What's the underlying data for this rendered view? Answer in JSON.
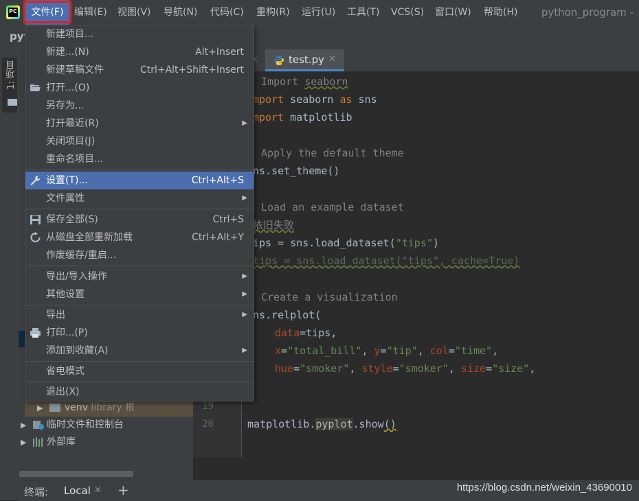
{
  "menubar": {
    "items": [
      "文件(F)",
      "编辑(E)",
      "视图(V)",
      "导航(N)",
      "代码(C)",
      "重构(R)",
      "运行(U)",
      "工具(T)",
      "VCS(S)",
      "窗口(W)",
      "帮助(H)"
    ],
    "project_title": "python_program -",
    "logo_text": "PC"
  },
  "navbar": {
    "crumb": "pyt"
  },
  "side_strip": {
    "project_tab": "1: 项目"
  },
  "file_menu": {
    "items": [
      {
        "label": "新建项目...",
        "shortcut": "",
        "icon": ""
      },
      {
        "label": "新建...(N)",
        "shortcut": "Alt+Insert",
        "icon": ""
      },
      {
        "label": "新建草稿文件",
        "shortcut": "Ctrl+Alt+Shift+Insert",
        "icon": ""
      },
      {
        "label": "打开...(O)",
        "shortcut": "",
        "icon": "folder-open-icon"
      },
      {
        "label": "另存为...",
        "shortcut": "",
        "icon": ""
      },
      {
        "label": "打开最近(R)",
        "shortcut": "",
        "icon": "",
        "submenu": true
      },
      {
        "label": "关闭项目(J)",
        "shortcut": "",
        "icon": ""
      },
      {
        "label": "重命名项目...",
        "shortcut": "",
        "icon": ""
      },
      {
        "label": "设置(T)...",
        "shortcut": "Ctrl+Alt+S",
        "icon": "wrench-icon",
        "selected": true
      },
      {
        "label": "文件属性",
        "shortcut": "",
        "icon": "",
        "submenu": true
      },
      {
        "label": "保存全部(S)",
        "shortcut": "Ctrl+S",
        "icon": "save-icon"
      },
      {
        "label": "从磁盘全部重新加载",
        "shortcut": "Ctrl+Alt+Y",
        "icon": "reload-icon"
      },
      {
        "label": "作废缓存/重启...",
        "shortcut": "",
        "icon": ""
      },
      {
        "label": "导出/导入操作",
        "shortcut": "",
        "icon": "",
        "submenu": true
      },
      {
        "label": "其他设置",
        "shortcut": "",
        "icon": "",
        "submenu": true
      },
      {
        "label": "导出",
        "shortcut": "",
        "icon": "",
        "submenu": true
      },
      {
        "label": "打印...(P)",
        "shortcut": "",
        "icon": "printer-icon"
      },
      {
        "label": "添加到收藏(A)",
        "shortcut": "",
        "icon": "",
        "submenu": true
      },
      {
        "label": "省电模式",
        "shortcut": "",
        "icon": ""
      },
      {
        "label": "退出(X)",
        "shortcut": "",
        "icon": ""
      }
    ]
  },
  "editor": {
    "tab": {
      "filename": "test.py"
    },
    "line_numbers": [
      "19",
      "20"
    ]
  },
  "project_tree": {
    "venv": {
      "name": "venv",
      "hint": "library 根"
    },
    "scratches": "临时文件和控制台",
    "external_libs": "外部库"
  },
  "bottom": {
    "terminal_label": "终端:",
    "terminal_tab": "Local",
    "add_symbol": "+"
  },
  "watermark": "https://blog.csdn.net/weixin_43690010"
}
